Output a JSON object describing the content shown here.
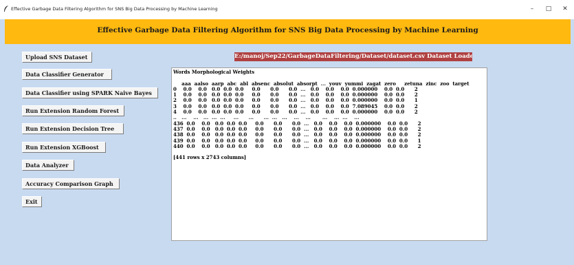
{
  "window": {
    "title": "Effective Garbage Data Filtering Algorithm for SNS Big Data Processing by Machine Learning",
    "minimize_glyph": "–",
    "maximize_glyph": "□",
    "close_glyph": "✕",
    "icon": "feather-icon"
  },
  "header": {
    "title": "Effective Garbage Data Filtering Algorithm for SNS Big Data Processing by Machine Learning",
    "background": "#ffb90f"
  },
  "status": {
    "text": "E:/manoj/Sep22/GarbageDataFiltering/Dataset/dataset.csv Dataset Loaded",
    "background": "#b04040"
  },
  "buttons": {
    "upload": "Upload SNS Dataset",
    "classifier_generator": "Data Classifier Generator",
    "spark_naive_bayes": "Data Classifier using SPARK Naive Bayes",
    "random_forest": "Run Extension Random Forest",
    "decision_tree": "Run Extension Decision Tree",
    "xgboost": "Run Extension XGBoost",
    "data_analyzer": "Data Analyzer",
    "accuracy_graph": "Accuracy Comparison Graph",
    "exit": "Exit"
  },
  "output": {
    "text": "Words Morphological Weights\n\n     aaa  aalso  aarp  abc  abl  absenc  absolut  absorpt  ...  youv  yummi  zagat  zero     zetuna  zinc  zoo  target\n0    0.0    0.0   0.0  0.0  0.0     0.0      0.0      0.0  ...   0.0    0.0    0.0  0.000000    0.0  0.0      2\n1    0.0    0.0   0.0  0.0  0.0     0.0      0.0      0.0  ...   0.0    0.0    0.0  0.000000    0.0  0.0      2\n2    0.0    0.0   0.0  0.0  0.0     0.0      0.0      0.0  ...   0.0    0.0    0.0  0.000000    0.0  0.0      1\n3    0.0    0.0   0.0  0.0  0.0     0.0      0.0      0.0  ...   0.0    0.0    0.0  7.089045    0.0  0.0      2\n4    0.0    0.0   0.0  0.0  0.0     0.0      0.0      0.0  ...   0.0    0.0    0.0  0.000000    0.0  0.0      2\n..   ...    ...   ...  ...  ...     ...      ...      ...  ...   ...    ...    ...       ...    ...  ...    ...\n436  0.0    0.0   0.0  0.0  0.0     0.0      0.0      0.0  ...   0.0    0.0    0.0  0.000000    0.0  0.0      2\n437  0.0    0.0   0.0  0.0  0.0     0.0      0.0      0.0  ...   0.0    0.0    0.0  0.000000    0.0  0.0      2\n438  0.0    0.0   0.0  0.0  0.0     0.0      0.0      0.0  ...   0.0    0.0    0.0  0.000000    0.0  0.0      2\n439  0.0    0.0   0.0  0.0  0.0     0.0      0.0      0.0  ...   0.0    0.0    0.0  0.000000    0.0  0.0      1\n440  0.0    0.0   0.0  0.0  0.0     0.0      0.0      0.0  ...   0.0    0.0    0.0  0.000000    0.0  0.0      2\n\n[441 rows x 2743 columns]"
  }
}
